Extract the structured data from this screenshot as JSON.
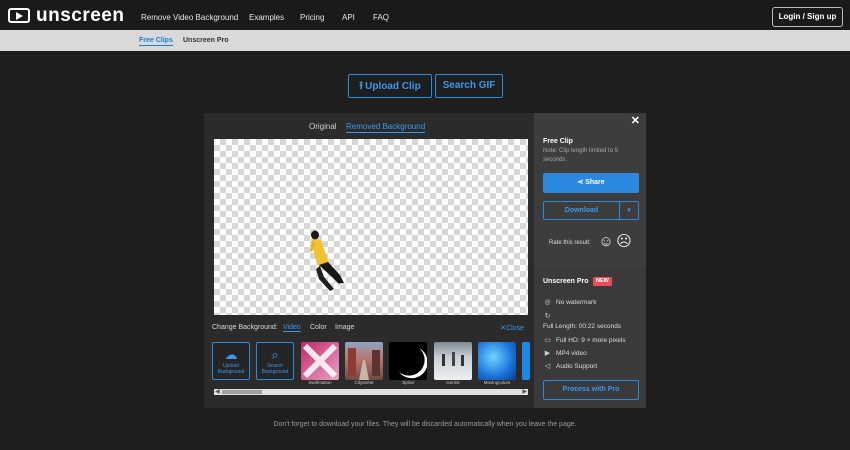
{
  "brand": {
    "name": "unscreen"
  },
  "nav": {
    "links": [
      "Remove Video Background",
      "Examples",
      "Pricing",
      "API",
      "FAQ"
    ],
    "login": "Login / Sign up"
  },
  "subnav": {
    "links": [
      "Free Clips",
      "Unscreen Pro"
    ]
  },
  "upload": {
    "upload_label": "Upload Clip",
    "search_label": "Search GIF"
  },
  "editor": {
    "tabs": [
      "Original",
      "Removed Background"
    ],
    "change_bg_label": "Change Background:",
    "bg_options": [
      "Video",
      "Color",
      "Image"
    ],
    "close_label": "Close",
    "thumbs": [
      {
        "icon": "upload-icon",
        "label": "Upload Background"
      },
      {
        "icon": "search-icon",
        "label": "Search Background"
      }
    ],
    "bg_thumbs": [
      "Swirlmation",
      "Citystreet",
      "Spiral",
      "Icerink",
      "Movingcolors"
    ]
  },
  "side": {
    "close_symbol": "✕",
    "free_title": "Free Clip",
    "free_note": "Note: Clip length limited to 5 seconds.",
    "share_label": "Share",
    "download_label": "Download",
    "rate_label": "Rate this result:",
    "pro_title": "Unscreen Pro",
    "new_badge": "NEW",
    "features": [
      "No watermark",
      "Full Length: 00:22 seconds",
      "Full HD: 9 × more pixels",
      "MP4 video",
      "Audio Support"
    ],
    "pro_button": "Process with Pro"
  },
  "footer": {
    "note": "Don't forget to download your files. They will be discarded automatically when you leave the page."
  },
  "colors": {
    "accent": "#2b8ae0",
    "badge": "#e84c5a"
  }
}
